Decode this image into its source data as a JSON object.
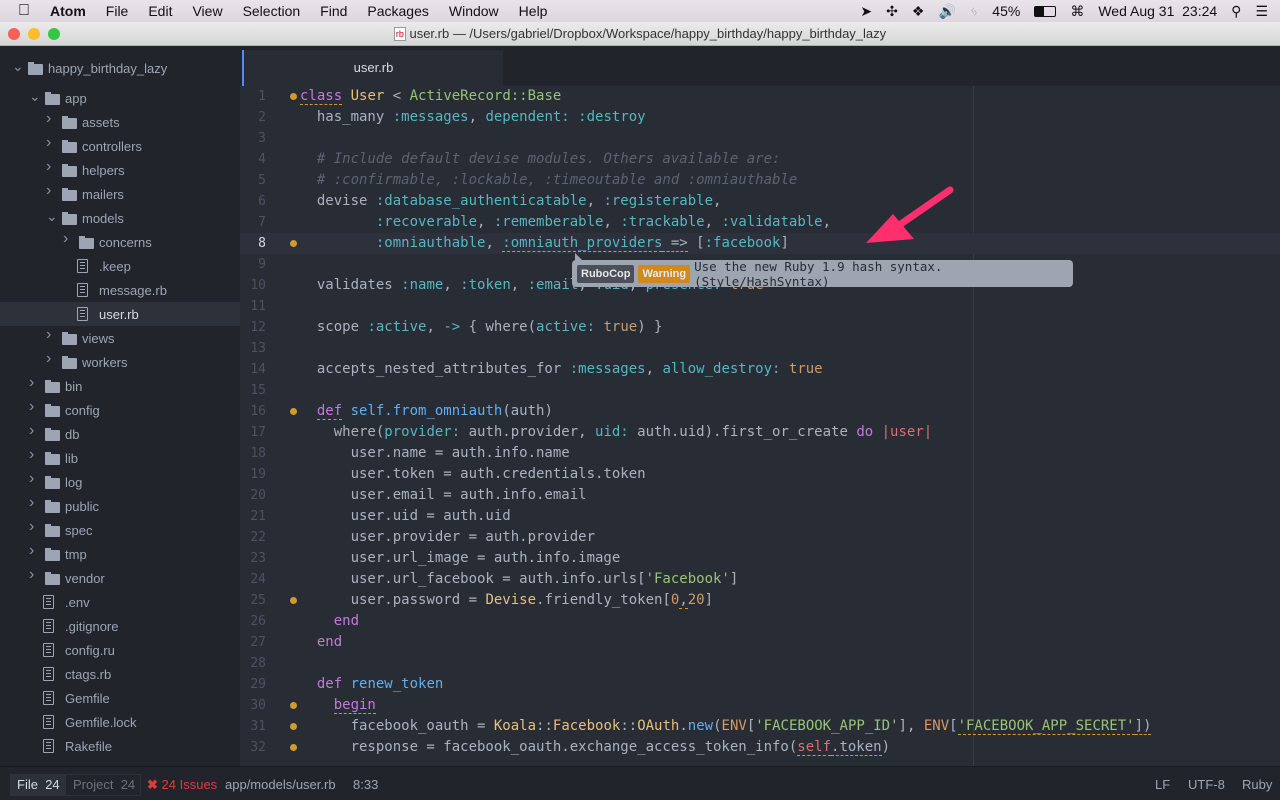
{
  "menubar": {
    "apple": "",
    "app": "Atom",
    "items": [
      "File",
      "Edit",
      "View",
      "Selection",
      "Find",
      "Packages",
      "Window",
      "Help"
    ],
    "battery": "45%",
    "clock": "Wed Aug 31  23:24"
  },
  "window": {
    "title": "user.rb — /Users/gabriel/Dropbox/Workspace/happy_birthday/happy_birthday_lazy",
    "file_icon_text": "rb"
  },
  "tree": [
    {
      "label": "happy_birthday_lazy",
      "type": "folder",
      "open": true,
      "depth": 0
    },
    {
      "label": "app",
      "type": "folder",
      "open": true,
      "depth": 1
    },
    {
      "label": "assets",
      "type": "folder",
      "open": false,
      "depth": 2
    },
    {
      "label": "controllers",
      "type": "folder",
      "open": false,
      "depth": 2
    },
    {
      "label": "helpers",
      "type": "folder",
      "open": false,
      "depth": 2
    },
    {
      "label": "mailers",
      "type": "folder",
      "open": false,
      "depth": 2
    },
    {
      "label": "models",
      "type": "folder",
      "open": true,
      "depth": 2
    },
    {
      "label": "concerns",
      "type": "folder",
      "open": false,
      "depth": 3
    },
    {
      "label": ".keep",
      "type": "file",
      "depth": 3
    },
    {
      "label": "message.rb",
      "type": "file",
      "depth": 3
    },
    {
      "label": "user.rb",
      "type": "file",
      "depth": 3,
      "selected": true
    },
    {
      "label": "views",
      "type": "folder",
      "open": false,
      "depth": 2
    },
    {
      "label": "workers",
      "type": "folder",
      "open": false,
      "depth": 2
    },
    {
      "label": "bin",
      "type": "folder",
      "open": false,
      "depth": 1
    },
    {
      "label": "config",
      "type": "folder",
      "open": false,
      "depth": 1
    },
    {
      "label": "db",
      "type": "folder",
      "open": false,
      "depth": 1
    },
    {
      "label": "lib",
      "type": "folder",
      "open": false,
      "depth": 1
    },
    {
      "label": "log",
      "type": "folder",
      "open": false,
      "depth": 1
    },
    {
      "label": "public",
      "type": "folder",
      "open": false,
      "depth": 1
    },
    {
      "label": "spec",
      "type": "folder",
      "open": false,
      "depth": 1
    },
    {
      "label": "tmp",
      "type": "folder",
      "open": false,
      "depth": 1
    },
    {
      "label": "vendor",
      "type": "folder",
      "open": false,
      "depth": 1
    },
    {
      "label": ".env",
      "type": "file",
      "depth": 1
    },
    {
      "label": ".gitignore",
      "type": "file",
      "depth": 1
    },
    {
      "label": "config.ru",
      "type": "file",
      "depth": 1
    },
    {
      "label": "ctags.rb",
      "type": "file",
      "depth": 1
    },
    {
      "label": "Gemfile",
      "type": "file",
      "depth": 1
    },
    {
      "label": "Gemfile.lock",
      "type": "file",
      "depth": 1
    },
    {
      "label": "Rakefile",
      "type": "file",
      "depth": 1
    }
  ],
  "tab": {
    "label": "user.rb"
  },
  "editor": {
    "cursor_line": 8,
    "lines": [
      {
        "n": 1,
        "dot": true,
        "t": [
          [
            "class",
            "k u"
          ],
          [
            " "
          ],
          [
            "User",
            "c"
          ],
          [
            " < "
          ],
          [
            "ActiveRecord::Base",
            "str"
          ]
        ]
      },
      {
        "n": 2,
        "t": [
          [
            "  has_many "
          ],
          [
            ":messages",
            "s"
          ],
          [
            ", "
          ],
          [
            "dependent:",
            "s"
          ],
          [
            " "
          ],
          [
            ":destroy",
            "s"
          ]
        ]
      },
      {
        "n": 3,
        "t": []
      },
      {
        "n": 4,
        "t": [
          [
            "  "
          ],
          [
            "# Include default devise modules. Others available are:",
            "cm"
          ]
        ]
      },
      {
        "n": 5,
        "t": [
          [
            "  "
          ],
          [
            "# :confirmable, :lockable, :timeoutable and :omniauthable",
            "cm"
          ]
        ]
      },
      {
        "n": 6,
        "t": [
          [
            "  devise "
          ],
          [
            ":database_authenticatable",
            "s"
          ],
          [
            ", "
          ],
          [
            ":registerable",
            "s"
          ],
          [
            ","
          ]
        ]
      },
      {
        "n": 7,
        "t": [
          [
            "         "
          ],
          [
            ":recoverable",
            "s"
          ],
          [
            ", "
          ],
          [
            ":rememberable",
            "s"
          ],
          [
            ", "
          ],
          [
            ":trackable",
            "s"
          ],
          [
            ", "
          ],
          [
            ":validatable",
            "s"
          ],
          [
            ","
          ]
        ]
      },
      {
        "n": 8,
        "dot": true,
        "t": [
          [
            "         "
          ],
          [
            ":omniauthable",
            "s"
          ],
          [
            ", "
          ],
          [
            ":omniauth_providers",
            "s u"
          ],
          [
            " =>",
            "u"
          ],
          [
            " ["
          ],
          [
            ":facebook",
            "s"
          ],
          [
            "]"
          ]
        ]
      },
      {
        "n": 9,
        "t": []
      },
      {
        "n": 10,
        "t": [
          [
            "  validates "
          ],
          [
            ":name",
            "s"
          ],
          [
            ", "
          ],
          [
            ":token",
            "s"
          ],
          [
            ", "
          ],
          [
            ":email",
            "s"
          ],
          [
            ", "
          ],
          [
            ":uid",
            "s"
          ],
          [
            ", "
          ],
          [
            "presence:",
            "s"
          ],
          [
            " "
          ],
          [
            "true",
            "b"
          ]
        ]
      },
      {
        "n": 11,
        "t": []
      },
      {
        "n": 12,
        "t": [
          [
            "  scope "
          ],
          [
            ":active",
            "s"
          ],
          [
            ", "
          ],
          [
            "->",
            "s"
          ],
          [
            " { where("
          ],
          [
            "active:",
            "s"
          ],
          [
            " "
          ],
          [
            "true",
            "b"
          ],
          [
            ") }"
          ]
        ]
      },
      {
        "n": 13,
        "t": []
      },
      {
        "n": 14,
        "t": [
          [
            "  accepts_nested_attributes_for "
          ],
          [
            ":messages",
            "s"
          ],
          [
            ", "
          ],
          [
            "allow_destroy:",
            "s"
          ],
          [
            " "
          ],
          [
            "true",
            "b"
          ]
        ]
      },
      {
        "n": 15,
        "t": []
      },
      {
        "n": 16,
        "dot": true,
        "t": [
          [
            "  "
          ],
          [
            "def",
            "k u"
          ],
          [
            " "
          ],
          [
            "self.from_omniauth",
            "f"
          ],
          [
            "(auth)"
          ]
        ]
      },
      {
        "n": 17,
        "t": [
          [
            "    where("
          ],
          [
            "provider:",
            "s"
          ],
          [
            " auth.provider, "
          ],
          [
            "uid:",
            "s"
          ],
          [
            " auth.uid).first_or_create "
          ],
          [
            "do",
            "k"
          ],
          [
            " "
          ],
          [
            "|user|",
            "v"
          ]
        ]
      },
      {
        "n": 18,
        "t": [
          [
            "      user.name = auth.info.name"
          ]
        ]
      },
      {
        "n": 19,
        "t": [
          [
            "      user.token = auth.credentials.token"
          ]
        ]
      },
      {
        "n": 20,
        "t": [
          [
            "      user.email = auth.info.email"
          ]
        ]
      },
      {
        "n": 21,
        "t": [
          [
            "      user.uid = auth.uid"
          ]
        ]
      },
      {
        "n": 22,
        "t": [
          [
            "      user.provider = auth.provider"
          ]
        ]
      },
      {
        "n": 23,
        "t": [
          [
            "      user.url_image = auth.info.image"
          ]
        ]
      },
      {
        "n": 24,
        "t": [
          [
            "      user.url_facebook = auth.info.urls["
          ],
          [
            "'Facebook'",
            "str"
          ],
          [
            "]"
          ]
        ]
      },
      {
        "n": 25,
        "dot": true,
        "t": [
          [
            "      user.password = "
          ],
          [
            "Devise",
            "c"
          ],
          [
            ".friendly_token["
          ],
          [
            "0",
            "b"
          ],
          [
            ",",
            "u"
          ],
          [
            "20",
            "b"
          ],
          [
            "]"
          ]
        ]
      },
      {
        "n": 26,
        "t": [
          [
            "    "
          ],
          [
            "end",
            "k"
          ]
        ]
      },
      {
        "n": 27,
        "t": [
          [
            "  "
          ],
          [
            "end",
            "k"
          ]
        ]
      },
      {
        "n": 28,
        "t": []
      },
      {
        "n": 29,
        "t": [
          [
            "  "
          ],
          [
            "def",
            "k"
          ],
          [
            " "
          ],
          [
            "renew_token",
            "f"
          ]
        ]
      },
      {
        "n": 30,
        "dot": true,
        "t": [
          [
            "    "
          ],
          [
            "begin",
            "k u"
          ]
        ]
      },
      {
        "n": 31,
        "dot": true,
        "t": [
          [
            "      facebook_oauth = "
          ],
          [
            "Koala",
            "c"
          ],
          [
            "::"
          ],
          [
            "Facebook",
            "c"
          ],
          [
            "::"
          ],
          [
            "OAuth",
            "c"
          ],
          [
            "."
          ],
          [
            "new",
            "f"
          ],
          [
            "("
          ],
          [
            "ENV",
            "b"
          ],
          [
            "["
          ],
          [
            "'FACEBOOK_APP_ID'",
            "str"
          ],
          [
            "], "
          ],
          [
            "ENV",
            "b"
          ],
          [
            "["
          ],
          [
            "'FACEBOOK_APP_SECRET'",
            "str u"
          ],
          [
            "])",
            "u"
          ]
        ]
      },
      {
        "n": 32,
        "dot": true,
        "t": [
          [
            "      response = facebook_oauth.exchange_access_token_info("
          ],
          [
            "self",
            "v u"
          ],
          [
            ".token",
            "u"
          ],
          [
            ")"
          ]
        ]
      }
    ]
  },
  "tooltip": {
    "source": "RuboCop",
    "severity": "Warning",
    "message": "Use the new Ruby 1.9 hash syntax. (Style/HashSyntax)",
    "source_color": "#4a4f59",
    "severity_color": "#d08a1c"
  },
  "annotation": {
    "arrow_color": "#ff2f6e"
  },
  "statusbar": {
    "file_tab": "File",
    "file_count": "24",
    "project_tab": "Project",
    "project_count": "24",
    "issues": "24 Issues",
    "issues_color": "#e0393e",
    "path": "app/models/user.rb",
    "cursor": "8:33",
    "line_ending": "LF",
    "encoding": "UTF-8",
    "grammar": "Ruby"
  }
}
